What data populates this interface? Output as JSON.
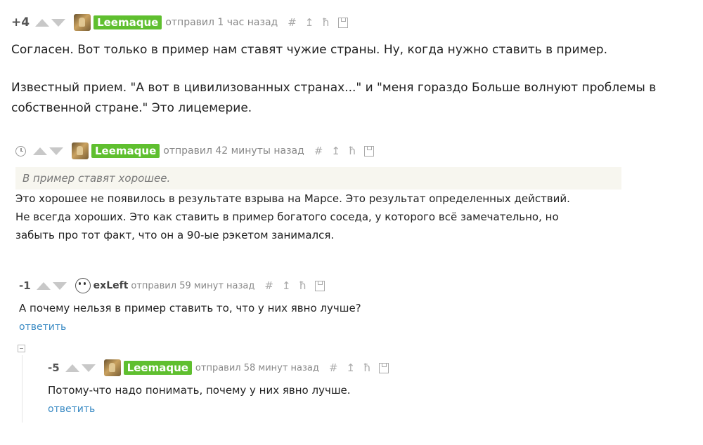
{
  "comments": [
    {
      "rating": "+4",
      "author": "Leemaque",
      "meta": "отправил 1 час назад",
      "paragraphs": [
        "Согласен. Вот только в пример нам ставят чужие страны. Ну, когда нужно ставить в пример.",
        "Известный прием. \"А вот в цивилизованных странах...\" и \"меня гораздо Больше волнуют проблемы в",
        "собственной стране.\" Это лицемерие."
      ]
    },
    {
      "author": "Leemaque",
      "meta": "отправил 42 минуты назад",
      "quote": "В пример ставят хорошее.",
      "lines": [
        "Это хорошее не появилось в результате взрыва на Марсе. Это результат определенных действий.",
        "Не всегда хороших. Это как ставить в пример богатого соседа, у которого всё замечательно, но",
        "забыть про тот факт, что он а 90-ые рэкетом занимался."
      ]
    },
    {
      "rating": "-1",
      "author": "exLeft",
      "meta": "отправил 59 минут назад",
      "text": "А почему нельзя в пример ставить то, что у них явно лучше?",
      "reply": "ответить"
    },
    {
      "rating": "-5",
      "author": "Leemaque",
      "meta": "отправил 58 минут назад",
      "text": "Потому-что надо понимать, почему у них явно лучше.",
      "reply": "ответить"
    }
  ],
  "icons": {
    "hash": "#",
    "up": "↥",
    "tree": "ħ"
  }
}
